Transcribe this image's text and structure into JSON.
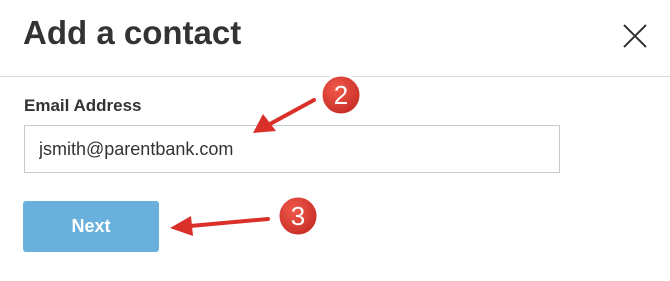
{
  "dialog": {
    "title": "Add a contact",
    "close_icon": "close-x-icon"
  },
  "form": {
    "email_label": "Email Address",
    "email_value": "jsmith@parentbank.com",
    "next_label": "Next"
  },
  "annotations": {
    "step_2": "2",
    "step_3": "3"
  },
  "colors": {
    "title_text": "#333333",
    "button_bg": "#6ab0dc",
    "button_text": "#ffffff",
    "annotation_red": "#d9302a",
    "divider": "#dcdcdc",
    "input_border": "#c9c9c9"
  }
}
